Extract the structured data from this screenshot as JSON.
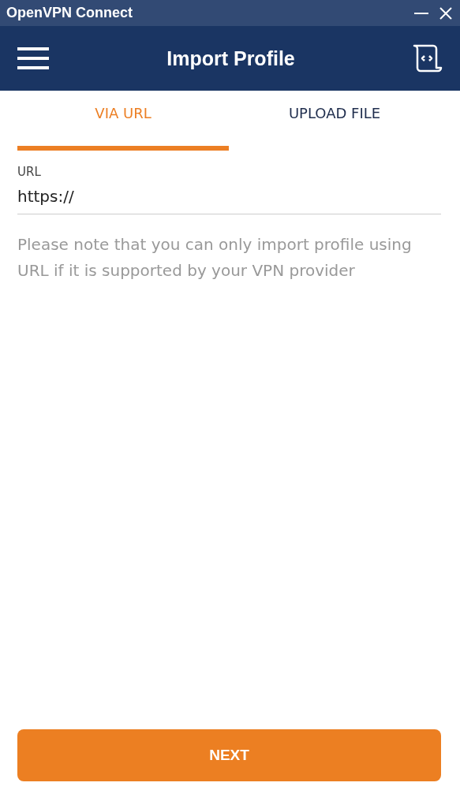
{
  "window": {
    "title": "OpenVPN Connect"
  },
  "header": {
    "title": "Import Profile"
  },
  "tabs": [
    {
      "label": "VIA URL",
      "selected": true
    },
    {
      "label": "UPLOAD FILE",
      "selected": false
    }
  ],
  "url_field": {
    "label": "URL",
    "value": "https://"
  },
  "note": "Please note that you can only import profile using URL if it is supported by your VPN provider",
  "next_button": {
    "label": "NEXT"
  }
}
